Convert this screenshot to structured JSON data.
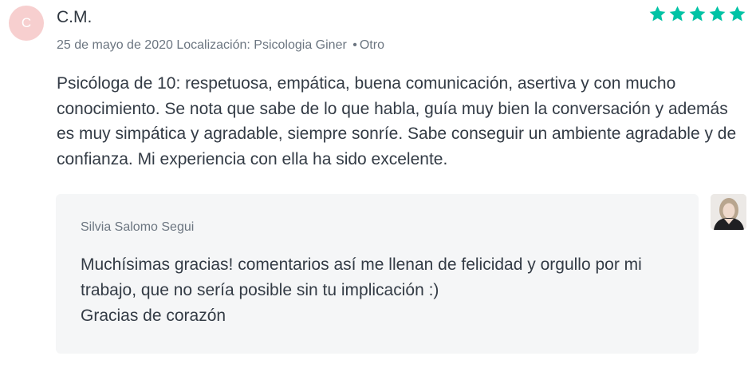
{
  "review": {
    "avatar_initial": "C",
    "author": "C.M.",
    "rating": 5,
    "rating_max": 5,
    "date": "25 de mayo de 2020",
    "location": "Localización: Psicologia Giner",
    "separator": "•",
    "category": "Otro",
    "text": "Psicóloga de 10: respetuosa, empática, buena comunicación, asertiva y con mucho conocimiento. Se nota que sabe de lo que habla, guía muy bien la conversación y además es muy simpática y agradable, siempre sonríe. Sabe conseguir un ambiente agradable y de confianza. Mi experiencia con ella ha sido excelente."
  },
  "reply": {
    "author": "Silvia Salomo Segui",
    "lines": [
      "Muchísimas gracias! comentarios así me llenan de felicidad y orgullo por mi trabajo, que no sería posible sin tu implicación :)",
      "Gracias de corazón"
    ]
  },
  "colors": {
    "star": "#00c3a5",
    "avatar_bg": "#f7cfcf",
    "reply_bg": "#f5f6f7"
  },
  "icons": {
    "star": "star-icon",
    "reply_avatar": "profile-photo"
  }
}
